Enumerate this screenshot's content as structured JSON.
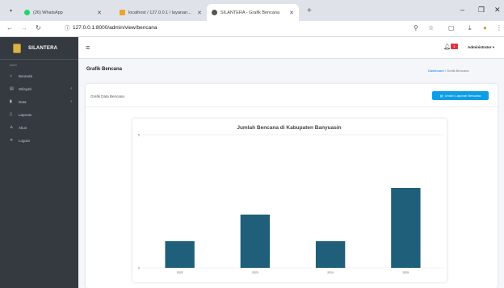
{
  "browser": {
    "tabs": [
      {
        "title": "(26) WhatsApp",
        "color": "#25d366"
      },
      {
        "title": "localhost / 127.0.0.1 / layanan...",
        "color": "#f0a030"
      },
      {
        "title": "SILANTERA - Grafik Bencana",
        "color": "#555555"
      }
    ],
    "url": "127.0.0.1:8000/admin/view/bencana"
  },
  "sidebar": {
    "brand": "SILANTERA",
    "menu_header": "MAIN",
    "items": [
      {
        "label": "Beranda",
        "icon": "home-icon"
      },
      {
        "label": "Wilayah",
        "icon": "map-icon"
      },
      {
        "label": "Data",
        "icon": "chart-icon"
      },
      {
        "label": "Laporan",
        "icon": "file-icon"
      },
      {
        "label": "Akun",
        "icon": "user-icon"
      },
      {
        "label": "Logout",
        "icon": "close-icon"
      }
    ]
  },
  "topnav": {
    "badge": "1",
    "user": "Administrator"
  },
  "page": {
    "title": "Grafik Bencana",
    "breadcrumb_home": "Dashboard",
    "breadcrumb_sep": "/",
    "breadcrumb_current": "Grafik Bencana"
  },
  "card": {
    "title": "Grafik Data Bencana",
    "download_label": "Unduh Laporan Bencana"
  },
  "chart_data": {
    "type": "bar",
    "title": "Jumlah Bencana di Kabupaten Banyuasin",
    "categories": [
      "2022",
      "2023",
      "2024",
      "2025"
    ],
    "values": [
      1,
      2,
      1,
      3
    ],
    "ylim": [
      0,
      5
    ],
    "yticks": [
      "0",
      "5"
    ],
    "bar_color": "#1f5f7a",
    "grid": true
  }
}
